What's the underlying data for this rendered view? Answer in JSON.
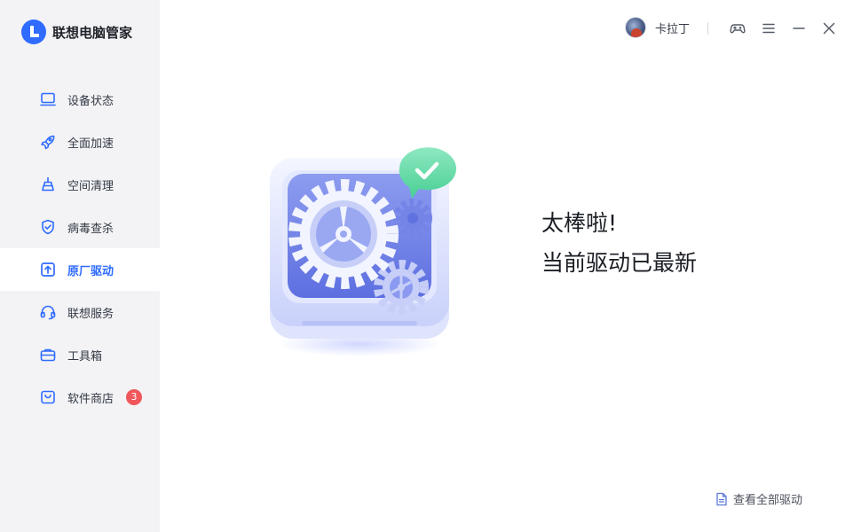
{
  "app": {
    "name": "联想电脑管家"
  },
  "colors": {
    "accent": "#2f6bff",
    "sidebar_bg": "#f3f3f5",
    "badge": "#f0575a",
    "check": "#4fd39a"
  },
  "sidebar": {
    "items": [
      {
        "label": "设备状态",
        "icon": "laptop-icon",
        "active": false
      },
      {
        "label": "全面加速",
        "icon": "rocket-icon",
        "active": false
      },
      {
        "label": "空间清理",
        "icon": "broom-icon",
        "active": false
      },
      {
        "label": "病毒查杀",
        "icon": "shield-check-icon",
        "active": false
      },
      {
        "label": "原厂驱动",
        "icon": "upload-square-icon",
        "active": true
      },
      {
        "label": "联想服务",
        "icon": "headset-icon",
        "active": false
      },
      {
        "label": "工具箱",
        "icon": "toolbox-icon",
        "active": false
      },
      {
        "label": "软件商店",
        "icon": "store-bag-icon",
        "active": false,
        "badge": "3"
      }
    ]
  },
  "header": {
    "username": "卡拉丁",
    "icons": [
      "gamepad-icon",
      "menu-icon",
      "minimize-icon",
      "close-icon"
    ]
  },
  "main": {
    "headline": "太棒啦!",
    "status": "当前驱动已最新",
    "view_all_label": "查看全部驱动"
  }
}
